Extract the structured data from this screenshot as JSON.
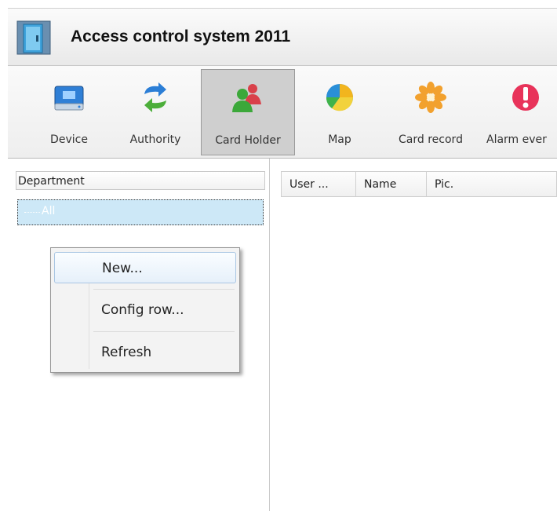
{
  "window": {
    "title": "Access control system 2011"
  },
  "toolbar": {
    "items": [
      {
        "label": "Device",
        "icon": "device-drive-icon",
        "active": false
      },
      {
        "label": "Authority",
        "icon": "sync-arrows-icon",
        "active": false
      },
      {
        "label": "Card Holder",
        "icon": "users-icon",
        "active": true
      },
      {
        "label": "Map",
        "icon": "pie-map-icon",
        "active": false
      },
      {
        "label": "Card record",
        "icon": "flower-record-icon",
        "active": false
      },
      {
        "label": "Alarm ever",
        "icon": "alarm-exclamation-icon",
        "active": false
      }
    ]
  },
  "left_panel": {
    "header": "Department",
    "tree": [
      {
        "label": "All"
      }
    ]
  },
  "grid": {
    "columns": [
      "User ...",
      "Name",
      "Pic."
    ]
  },
  "context_menu": {
    "items": [
      {
        "label": "New...",
        "highlighted": true
      },
      {
        "label": "Config row...",
        "highlighted": false
      },
      {
        "label": "Refresh",
        "highlighted": false
      }
    ]
  },
  "colors": {
    "selection_bg": "#cde8f7",
    "active_tool_bg": "#cfcfcf",
    "menu_highlight_border": "#a9c6e3"
  }
}
